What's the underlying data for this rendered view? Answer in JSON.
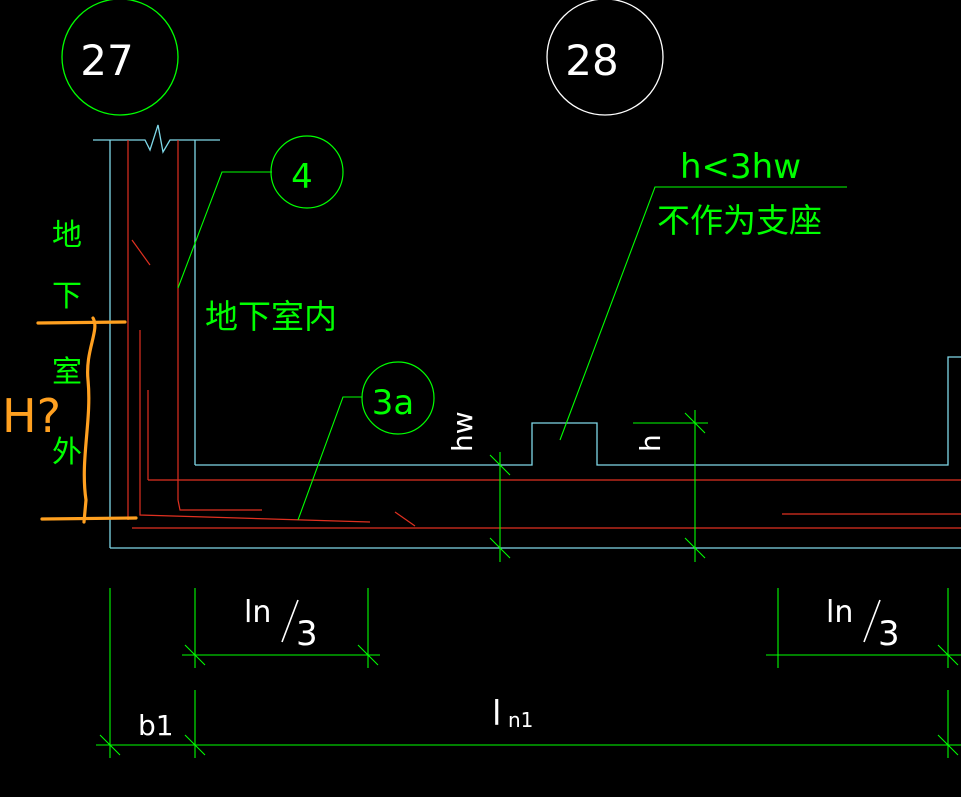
{
  "colors": {
    "background": "#000000",
    "green": "#00ff00",
    "cyan": "#7fd8e8",
    "red": "#e03020",
    "orange": "#ffa020",
    "white": "#ffffff"
  },
  "axis_bubbles": {
    "left": "27",
    "right": "28"
  },
  "rebar_tags": {
    "wall_bar": "4",
    "slab_bar": "3a"
  },
  "notes": {
    "condition": "h<3hw",
    "condition_desc": "不作为支座",
    "indoor_basement": "地下室内",
    "outdoor_basement_chars": [
      "地",
      "下",
      "室",
      "外"
    ]
  },
  "dimensions": {
    "hw": "hw",
    "h": "h",
    "ln_third_left_num": "ln",
    "ln_third_left_den": "3",
    "ln_third_right_num": "ln",
    "ln_third_right_den": "3",
    "ln1_main": "l",
    "ln1_sub": "n1",
    "b1": "b1"
  },
  "annotation": {
    "question": "H?"
  }
}
